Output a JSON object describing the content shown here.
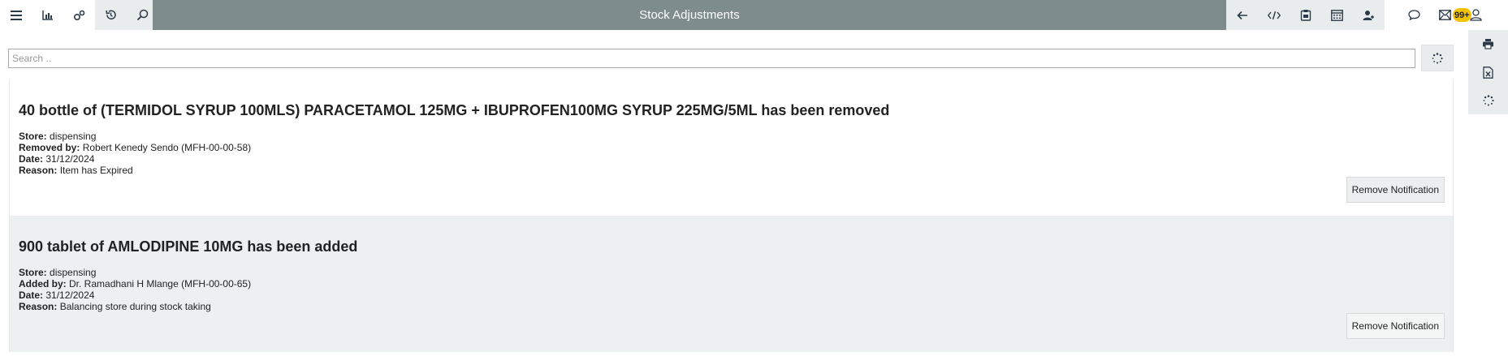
{
  "header": {
    "title": "Stock Adjustments",
    "badge_count": "99+"
  },
  "search": {
    "placeholder": "Search ..",
    "value": ""
  },
  "notifications": [
    {
      "title": "40 bottle of (TERMIDOL SYRUP 100MLS) PARACETAMOL 125MG + IBUPROFEN100MG SYRUP 225MG/5ML has been removed",
      "store_label": "Store:",
      "store": "dispensing",
      "by_label": "Removed by:",
      "by": "Robert Kenedy Sendo (MFH-00-00-58)",
      "date_label": "Date:",
      "date": "31/12/2024",
      "reason_label": "Reason:",
      "reason": "Item has Expired",
      "button": "Remove Notification"
    },
    {
      "title": "900 tablet of AMLODIPINE 10MG has been added",
      "store_label": "Store:",
      "store": "dispensing",
      "by_label": "Added by:",
      "by": "Dr. Ramadhani H Mlange (MFH-00-00-65)",
      "date_label": "Date:",
      "date": "31/12/2024",
      "reason_label": "Reason:",
      "reason": "Balancing store during stock taking",
      "button": "Remove Notification"
    }
  ]
}
